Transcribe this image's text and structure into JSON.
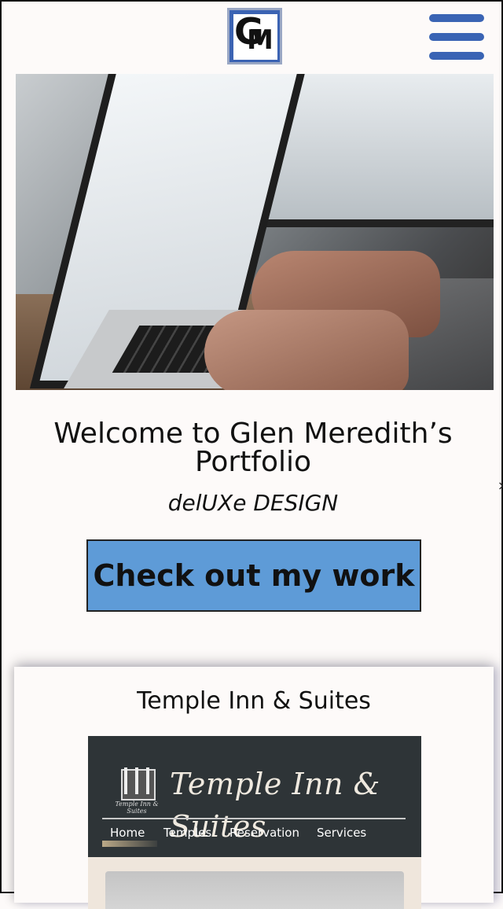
{
  "header": {
    "logo_letters": "GM",
    "logo_g": "G",
    "logo_m": "M",
    "menu_icon": "hamburger-menu-icon"
  },
  "hero": {
    "image_subject": "laptop typing photo"
  },
  "intro": {
    "welcome_line1": "Welcome to Glen Meredith’s",
    "welcome_line2": "Portfolio",
    "subtitle": "delUXe DESIGN",
    "cta_label": "Check out my work"
  },
  "side_close": "×",
  "project_card": {
    "title": "Temple Inn & Suites",
    "preview": {
      "brand": "Temple Inn & Suites",
      "emblem_caption": "Temple Inn & Suites",
      "nav": [
        "Home",
        "Temples",
        "Reservation",
        "Services"
      ]
    }
  },
  "colors": {
    "accent_blue": "#3a64b4",
    "cta_blue": "#5e9bd7",
    "background": "#fdfaf9",
    "preview_dark": "#2e3437"
  }
}
